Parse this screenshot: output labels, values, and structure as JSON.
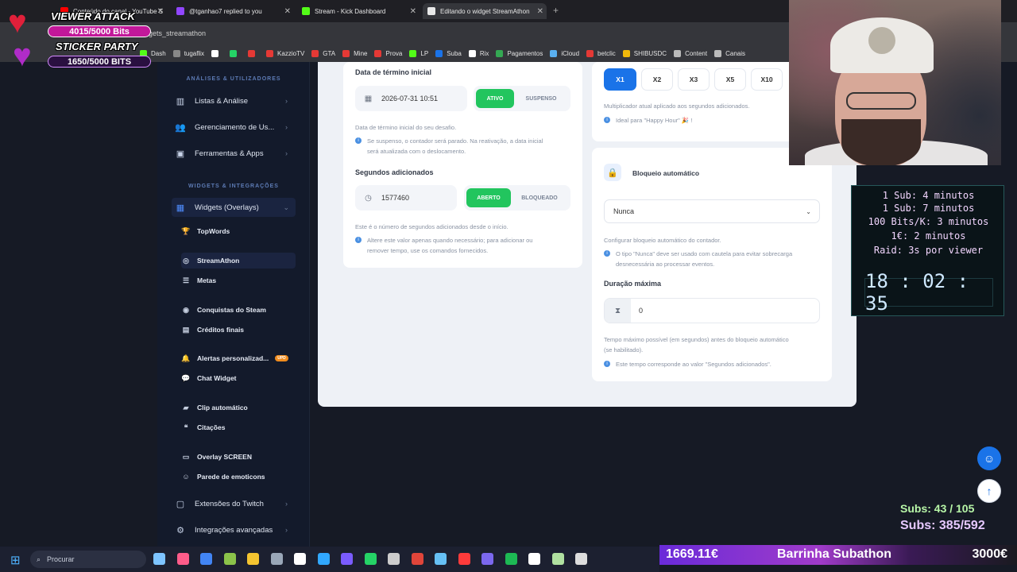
{
  "browser": {
    "tabs": [
      {
        "label": "Conteúdo do canal - YouTube S",
        "color": "#ff0000"
      },
      {
        "label": "@tganhao7 replied to you",
        "color": "#9146ff"
      },
      {
        "label": "Stream - Kick Dashboard",
        "color": "#53fc18"
      },
      {
        "label": "Editando o widget StreamAthon",
        "color": "#e8e8e8"
      }
    ],
    "url": "dgets_streamathon",
    "bookmarks": [
      {
        "label": "Dash",
        "color": "#53fc18"
      },
      {
        "label": "tugaflix",
        "color": "#888888"
      },
      {
        "label": "",
        "color": "#ffffff"
      },
      {
        "label": "",
        "color": "#25d366"
      },
      {
        "label": "",
        "color": "#e53935"
      },
      {
        "label": "KazzioTV",
        "color": "#e53935"
      },
      {
        "label": "GTA",
        "color": "#e53935"
      },
      {
        "label": "Mine",
        "color": "#e53935"
      },
      {
        "label": "Prova",
        "color": "#e53935"
      },
      {
        "label": "LP",
        "color": "#53fc18"
      },
      {
        "label": "Suba",
        "color": "#1a73e8"
      },
      {
        "label": "Rix",
        "color": "#ffffff"
      },
      {
        "label": "Pagamentos",
        "color": "#34a853"
      },
      {
        "label": "iCloud",
        "color": "#5ab0f0"
      },
      {
        "label": "betclic",
        "color": "#e53935"
      },
      {
        "label": "SHIBUSDC",
        "color": "#f0b90b"
      },
      {
        "label": "Content",
        "color": "#bbbbbb"
      },
      {
        "label": "Canais",
        "color": "#bbbbbb"
      }
    ]
  },
  "overlay_top": {
    "title1": "VIEWER ATTACK",
    "bar1": "4015/5000 Bits",
    "title2": "STICKER PARTY",
    "bar2": "1650/5000 BITS"
  },
  "sidebar": {
    "section1": "ANÁLISES & UTILIZADORES",
    "items1": [
      "Listas & Análise",
      "Gerenciamento de Us...",
      "Ferramentas & Apps"
    ],
    "section2": "WIDGETS & INTEGRAÇÕES",
    "widgets_label": "Widgets (Overlays)",
    "subitems": [
      "TopWords",
      "StreamAthon",
      "Metas",
      "Conquistas do Steam",
      "Créditos finais",
      "Alertas personalizad...",
      "Chat Widget",
      "Clip automático",
      "Citações",
      "Overlay SCREEN",
      "Parede de emoticons"
    ],
    "badge": "UPD",
    "items2": [
      "Extensões do Twitch",
      "Integrações avançadas"
    ]
  },
  "left_panel": {
    "end_title": "Data de término inicial",
    "end_value": "2026-07-31 10:51",
    "end_on": "ATIVO",
    "end_off": "SUSPENSO",
    "end_help": "Data de término inicial do seu desafio.",
    "end_info1": "Se suspenso, o contador será parado. Na reativação, a data inicial",
    "end_info2": "será atualizada com o deslocamento.",
    "sec_title": "Segundos adicionados",
    "sec_value": "1577460",
    "sec_on": "ABERTO",
    "sec_off": "BLOQUEADO",
    "sec_help": "Este é o número de segundos adicionados desde o início.",
    "sec_info1": "Altere este valor apenas quando necessário; para adicionar ou",
    "sec_info2": "remover tempo, use os comandos fornecidos."
  },
  "right_panel": {
    "multipliers": [
      "X1",
      "X2",
      "X3",
      "X5",
      "X10"
    ],
    "mult_help": "Multiplicador atual aplicado aos segundos adicionados.",
    "mult_info": "Ideal para \"Happy Hour\" 🎉 !",
    "lock_title": "Bloqueio automático",
    "lock_value": "Nunca",
    "lock_help": "Configurar bloqueio automático do contador.",
    "lock_info1": "O tipo \"Nunca\" deve ser usado com cautela para evitar sobrecarga",
    "lock_info2": "desnecessária ao processar eventos.",
    "dur_title": "Duração máxima",
    "dur_value": "0",
    "dur_help1": "Tempo máximo possível (em segundos) antes do bloqueio automático",
    "dur_help2": "(se habilitado).",
    "dur_info": "Este tempo corresponde ao valor \"Segundos adicionados\"."
  },
  "stream_overlay": {
    "rates": [
      "1 Sub: 4 minutos",
      "1 Sub: 7 minutos",
      "100 Bits/K: 3 minutos",
      "1€: 2 minutos",
      "Raid: 3s por viewer"
    ],
    "timer": "18 : 02 : 35",
    "subs1": "Subs: 43 / 105",
    "subs2": "Subs: 385/592",
    "bar_amount": "1669.11€",
    "bar_label": "Barrinha Subathon",
    "bar_goal": "3000€"
  },
  "taskbar": {
    "search": "Procurar"
  }
}
